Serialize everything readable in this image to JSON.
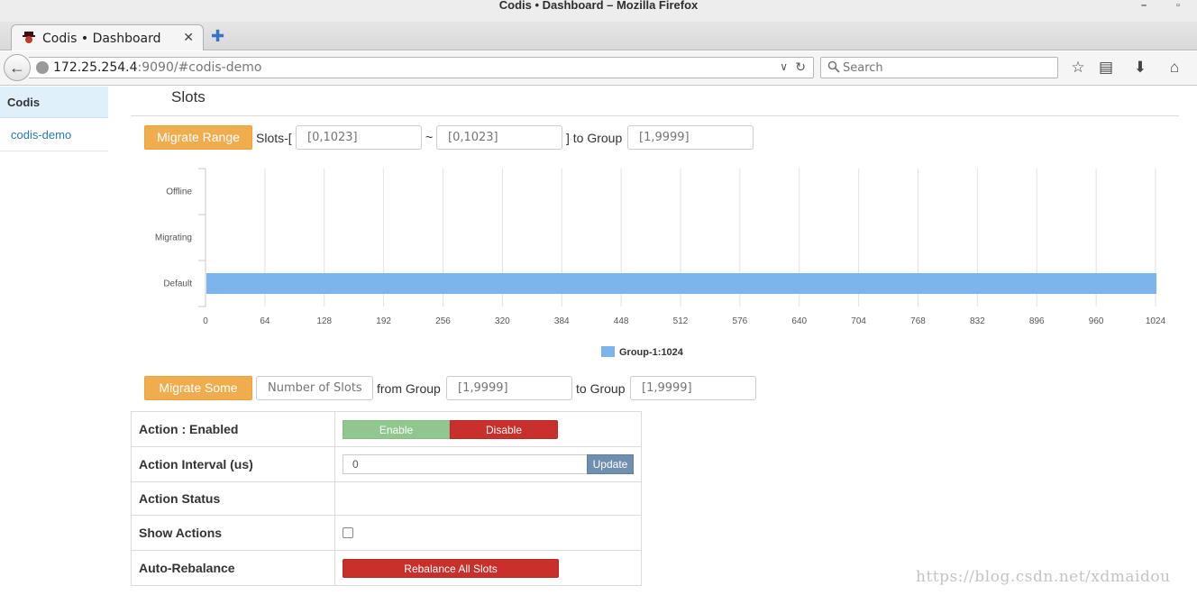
{
  "window": {
    "title": "Codis • Dashboard – Mozilla Firefox"
  },
  "browser": {
    "tab_label": "Codis • Dashboard",
    "url_host": "172.25.254.4",
    "url_rest": ":9090/#codis-demo",
    "search_placeholder": "Search"
  },
  "sidebar": {
    "brand": "Codis",
    "items": [
      {
        "label": "codis-demo"
      }
    ]
  },
  "page": {
    "title": "Slots"
  },
  "migrate_range": {
    "button": "Migrate Range",
    "slots_prefix": "Slots-[",
    "from_placeholder": "[0,1023]",
    "tilde": "~",
    "to_placeholder": "[0,1023]",
    "to_group_text": "] to Group",
    "group_placeholder": "[1,9999]"
  },
  "chart_data": {
    "type": "bar",
    "orientation": "horizontal",
    "categories": [
      "Offline",
      "Migrating",
      "Default"
    ],
    "series": [
      {
        "name": "Group-1:1024",
        "color": "#7cb5ec",
        "values": [
          0,
          0,
          1024
        ]
      }
    ],
    "xticks": [
      0,
      64,
      128,
      192,
      256,
      320,
      384,
      448,
      512,
      576,
      640,
      704,
      768,
      832,
      896,
      960,
      1024
    ],
    "xlim": [
      0,
      1024
    ],
    "grid": "vertical",
    "legend": "bottom-center"
  },
  "migrate_some": {
    "button": "Migrate Some",
    "count_placeholder": "Number of Slots",
    "from_group_text": "from Group",
    "from_placeholder": "[1,9999]",
    "to_group_text": "to Group",
    "to_placeholder": "[1,9999]"
  },
  "action_table": {
    "rows": [
      {
        "label": "Action : Enabled"
      },
      {
        "label": "Action Interval (us)"
      },
      {
        "label": "Action Status"
      },
      {
        "label": "Show Actions"
      },
      {
        "label": "Auto-Rebalance"
      }
    ],
    "enable_label": "Enable",
    "disable_label": "Disable",
    "interval_value": "0",
    "update_label": "Update",
    "rebalance_label": "Rebalance All Slots"
  },
  "watermark": "https://blog.csdn.net/xdmaidou"
}
